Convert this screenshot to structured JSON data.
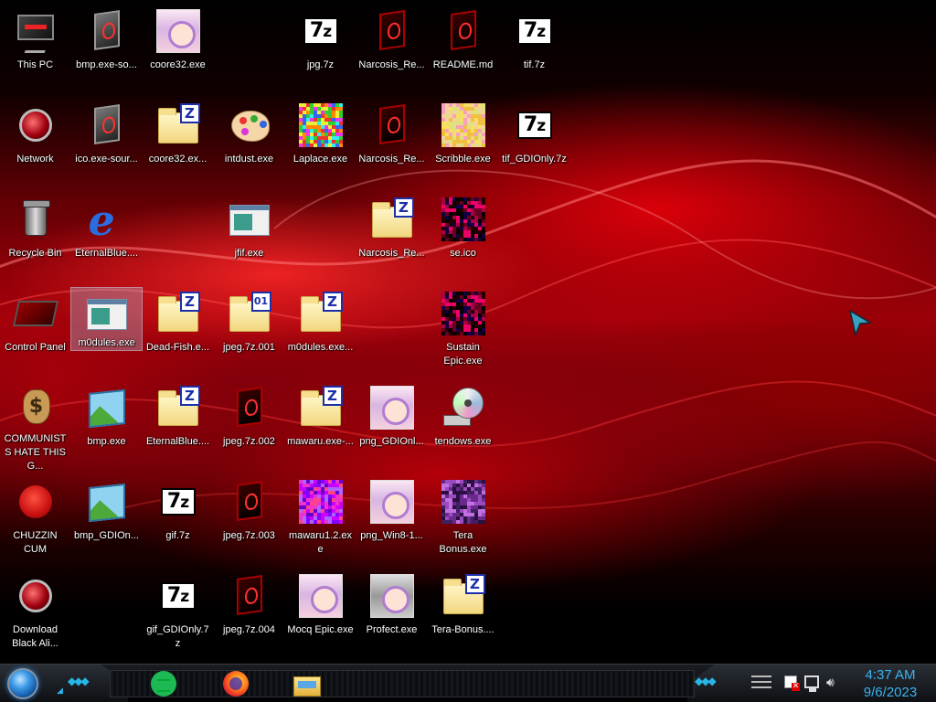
{
  "desktop": {
    "icons": [
      {
        "label": "This PC",
        "type": "pc"
      },
      {
        "label": "Network",
        "type": "globe"
      },
      {
        "label": "Recycle Bin",
        "type": "bin"
      },
      {
        "label": "Control Panel",
        "type": "panel"
      },
      {
        "label": "COMMUNISTS HATE THIS G...",
        "type": "bag"
      },
      {
        "label": "CHUZZIN CUM",
        "type": "fluff"
      },
      {
        "label": "Download Black Ali...",
        "type": "globe"
      },
      {
        "label": "bmp.exe-so...",
        "type": "alien-gray"
      },
      {
        "label": "ico.exe-sour...",
        "type": "alien-gray"
      },
      {
        "label": "EternalBlue....",
        "type": "ie"
      },
      {
        "label": "m0dules.exe",
        "type": "window",
        "selected": true
      },
      {
        "label": "bmp.exe",
        "type": "photo"
      },
      {
        "label": "bmp_GDIOn...",
        "type": "photo"
      },
      {
        "label": "coore32.exe",
        "type": "anime"
      },
      {
        "label": "coore32.ex...",
        "type": "zfolder"
      },
      {
        "label": "Dead-Fish.e...",
        "type": "zfolder"
      },
      {
        "label": "EternalBlue....",
        "type": "zfolder"
      },
      {
        "label": "gif.7z",
        "type": "7z"
      },
      {
        "label": "gif_GDIOnly.7z",
        "type": "7z"
      },
      {
        "label": "intdust.exe",
        "type": "palette"
      },
      {
        "label": "jfif.exe",
        "type": "window"
      },
      {
        "label": "jpeg.7z.001",
        "type": "zfolder",
        "badge": "01"
      },
      {
        "label": "jpeg.7z.002",
        "type": "alien"
      },
      {
        "label": "jpeg.7z.003",
        "type": "alien"
      },
      {
        "label": "jpeg.7z.004",
        "type": "alien"
      },
      {
        "label": "jpg.7z",
        "type": "7z"
      },
      {
        "label": "Laplace.exe",
        "type": "noise-rainbow"
      },
      {
        "label": "m0dules.exe...",
        "type": "zfolder"
      },
      {
        "label": "mawaru.exe-...",
        "type": "zfolder"
      },
      {
        "label": "mawaru1.2.exe",
        "type": "noise-purple"
      },
      {
        "label": "Mocq Epic.exe",
        "type": "anime"
      },
      {
        "label": "Narcosis_Re...",
        "type": "alien"
      },
      {
        "label": "Narcosis_Re...",
        "type": "alien"
      },
      {
        "label": "Narcosis_Re...",
        "type": "zfolder"
      },
      {
        "label": "png_GDIOnl...",
        "type": "anime"
      },
      {
        "label": "png_Win8-1...",
        "type": "anime"
      },
      {
        "label": "Profect.exe",
        "type": "anime-gray"
      },
      {
        "label": "README.md",
        "type": "alien"
      },
      {
        "label": "Scribble.exe",
        "type": "noise-yellow"
      },
      {
        "label": "se.ico",
        "type": "noise-dark"
      },
      {
        "label": "Sustain Epic.exe",
        "type": "noise-dark"
      },
      {
        "label": "tendows.exe",
        "type": "disc"
      },
      {
        "label": "Tera Bonus.exe",
        "type": "noise-purple2"
      },
      {
        "label": "Tera-Bonus....",
        "type": "zfolder"
      },
      {
        "label": "tif.7z",
        "type": "7z"
      },
      {
        "label": "tif_GDIOnly.7z",
        "type": "7z"
      }
    ]
  },
  "taskbar": {
    "start_label": "Start",
    "pinned": [
      {
        "name": "Spotify",
        "icon": "spotify-icon"
      },
      {
        "name": "Firefox",
        "icon": "firefox-icon"
      },
      {
        "name": "File Explorer",
        "icon": "folder-icon"
      }
    ],
    "clock": {
      "time": "4:37 AM",
      "date": "9/6/2023"
    },
    "colors": {
      "clock": "#3ab4f0",
      "accent": "#27b6e6"
    }
  }
}
